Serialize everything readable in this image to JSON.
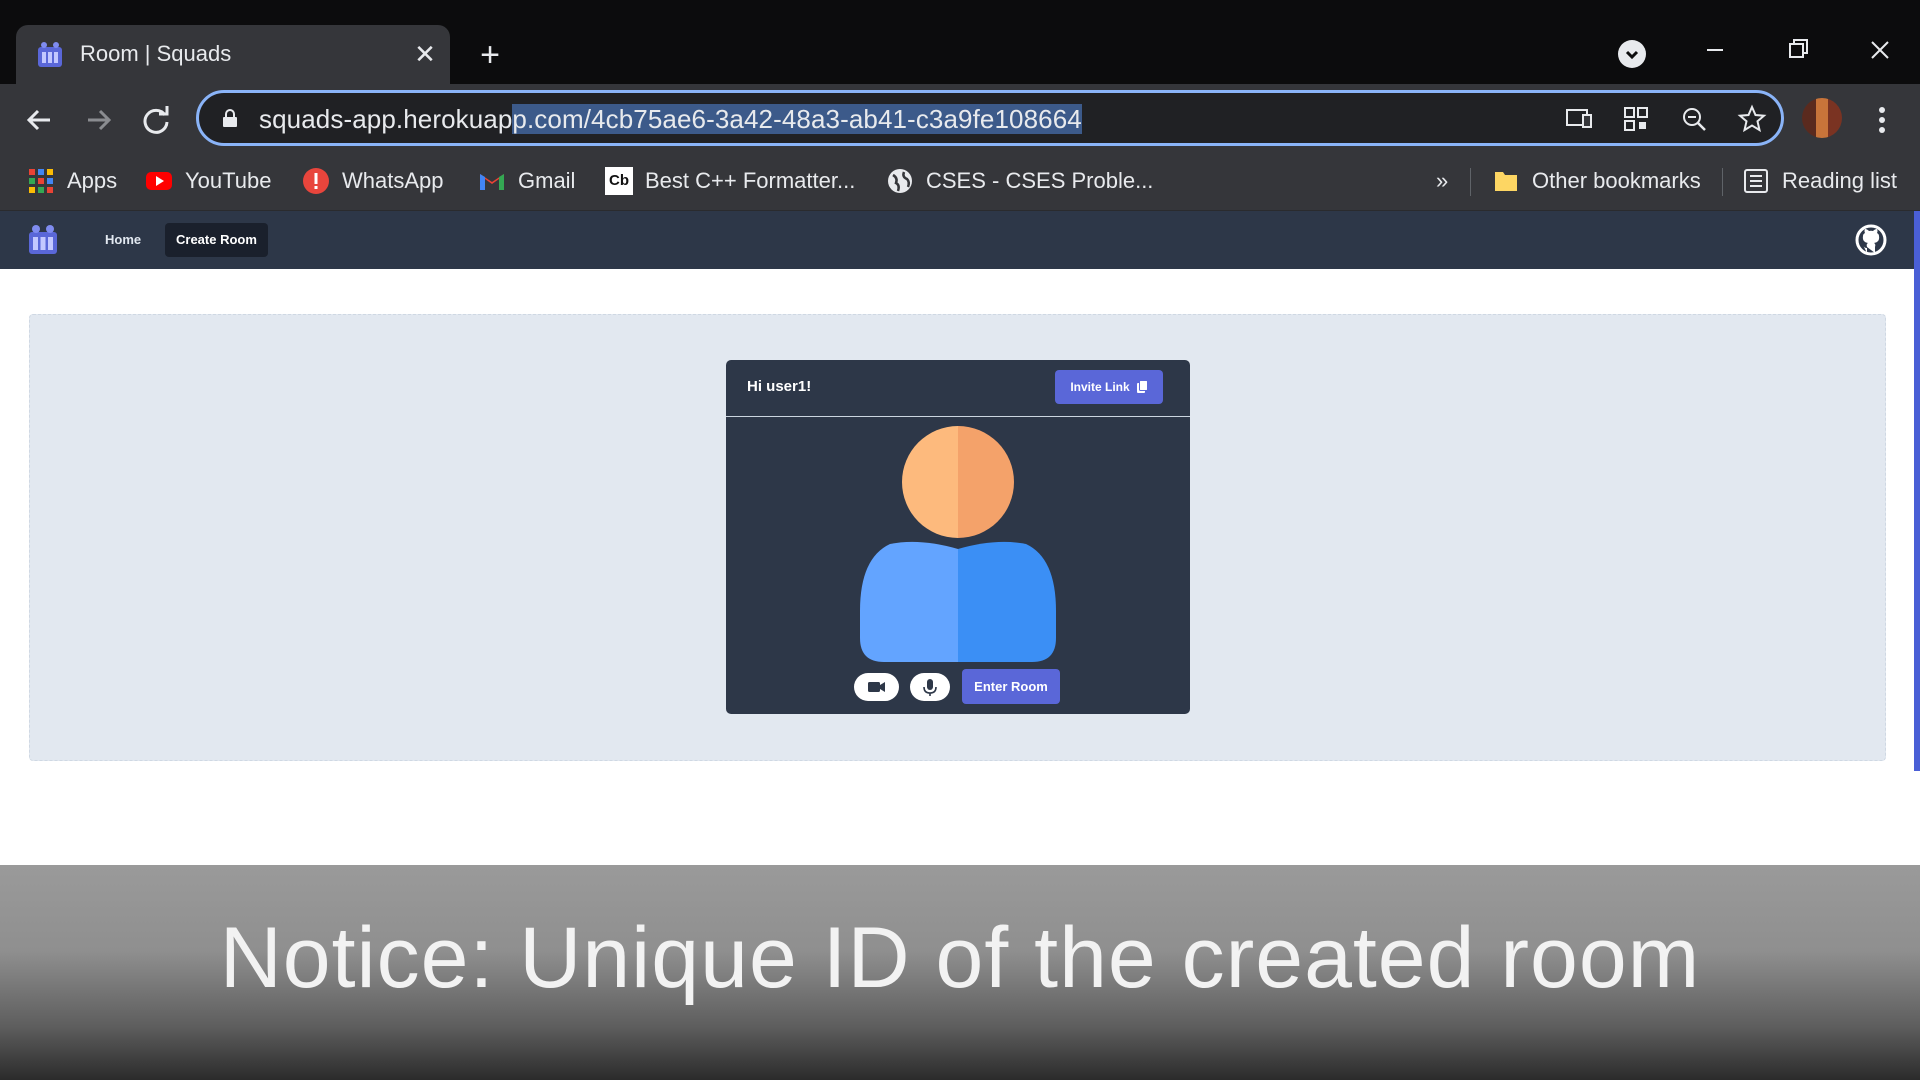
{
  "browser": {
    "tab": {
      "title": "Room | Squads",
      "close": "✕"
    },
    "new_tab": "+",
    "url": {
      "prefix": "squads-app.herokuap",
      "selected": "p.com/4cb75ae6-3a42-48a3-ab41-c3a9fe108664"
    },
    "bookmarks": {
      "apps": "Apps",
      "youtube": "YouTube",
      "whatsapp": "WhatsApp",
      "gmail": "Gmail",
      "cb_icon": "Cb",
      "cpp": "Best C++ Formatter...",
      "cses": "CSES - CSES Proble...",
      "overflow": "»",
      "other": "Other bookmarks",
      "reading": "Reading list"
    }
  },
  "app": {
    "nav": {
      "home": "Home",
      "create_room": "Create Room"
    },
    "card": {
      "greeting": "Hi user1!",
      "invite_label": "Invite Link",
      "enter_label": "Enter Room"
    }
  },
  "caption": "Notice: Unique ID of the created room",
  "colors": {
    "accent": "#5a67d8",
    "navbar": "#2d3748",
    "stage": "#e2e8f0",
    "head": "#f6ad79",
    "body": "#63a4ff"
  },
  "icons": [
    "squads-logo-icon",
    "close-icon",
    "plus-icon",
    "back-icon",
    "forward-icon",
    "reload-icon",
    "lock-icon",
    "cast-icon",
    "qr-icon",
    "zoom-icon",
    "star-icon",
    "github-icon",
    "copy-icon",
    "video-icon",
    "mic-icon"
  ]
}
